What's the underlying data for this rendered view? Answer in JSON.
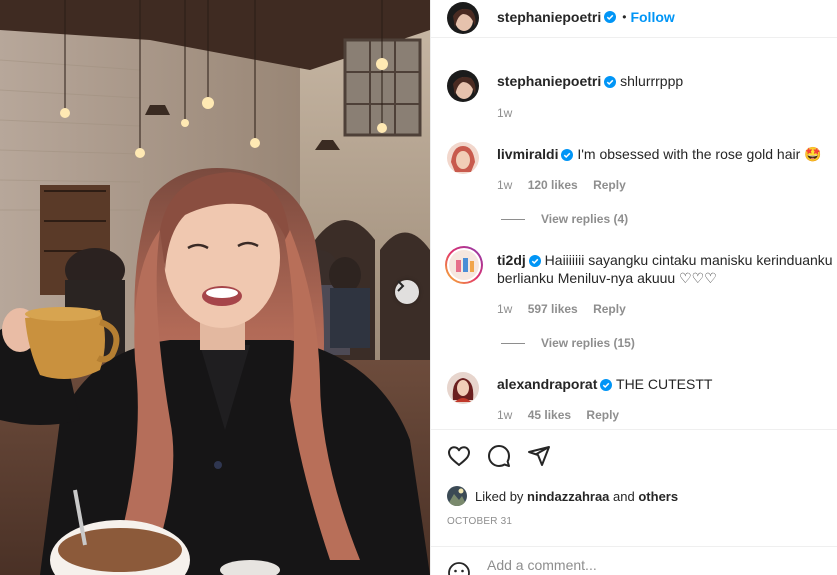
{
  "post": {
    "author": "stephaniepoetri",
    "follow_label": "Follow",
    "separator": "•"
  },
  "caption": {
    "username": "stephaniepoetri",
    "text": "shlurrrppp",
    "time": "1w"
  },
  "comments": [
    {
      "username": "livmiraldi",
      "text": "I'm obsessed with the rose gold hair 🤩",
      "time": "1w",
      "likes": "120 likes",
      "reply": "Reply",
      "view_replies": "View replies (4)"
    },
    {
      "username": "ti2dj",
      "text": "Haiiiiiii sayangku cintaku manisku kerinduanku berlianku Meniluv-nya akuuu ♡♡♡",
      "time": "1w",
      "likes": "597 likes",
      "reply": "Reply",
      "view_replies": "View replies (15)"
    },
    {
      "username": "alexandraporat",
      "text": "THE CUTESTT",
      "time": "1w",
      "likes": "45 likes",
      "reply": "Reply"
    }
  ],
  "likes": {
    "prefix": "Liked by",
    "user": "nindazzahraa",
    "conj": "and",
    "others": "others"
  },
  "date": "OCTOBER 31",
  "add_comment": {
    "placeholder": "Add a comment..."
  },
  "icons": [
    "heart-icon",
    "comment-icon",
    "share-icon",
    "emoji-icon",
    "verified-badge-icon",
    "next-arrow-icon"
  ],
  "colors": {
    "accent": "#0095f6",
    "text": "#262626",
    "muted": "#8e8e8e",
    "border": "#efefef"
  }
}
